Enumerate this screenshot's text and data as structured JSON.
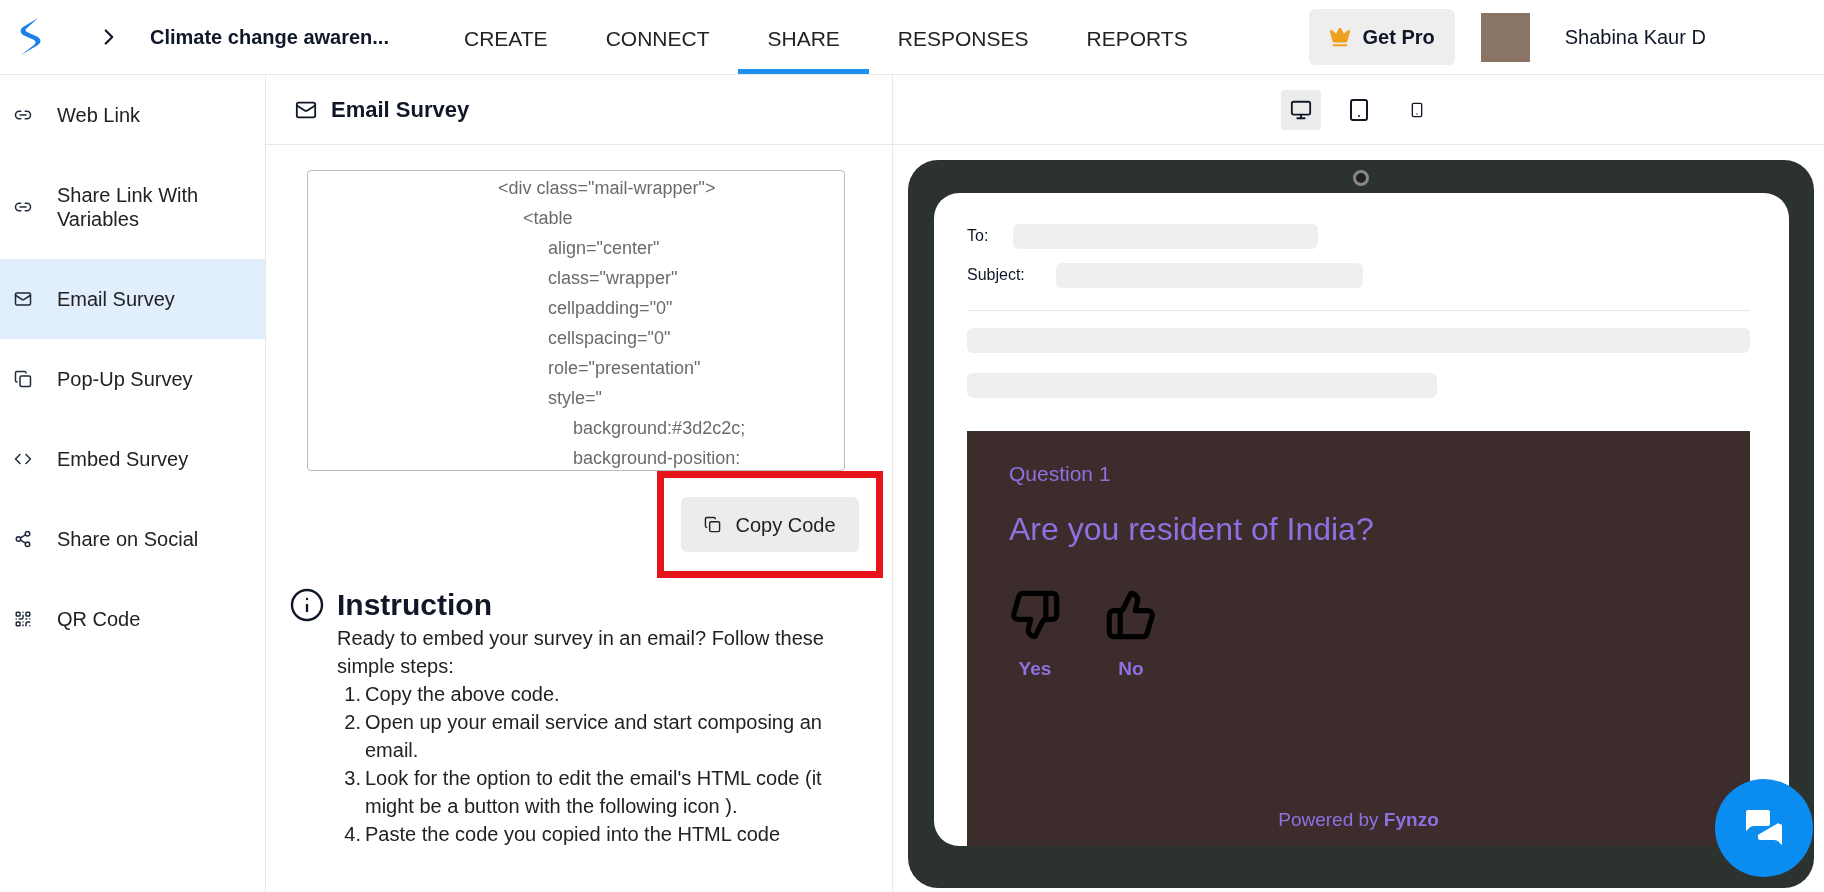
{
  "header": {
    "page_title": "Climate change awaren...",
    "tabs": [
      {
        "label": "CREATE",
        "selected": false
      },
      {
        "label": "CONNECT",
        "selected": false
      },
      {
        "label": "SHARE",
        "selected": true
      },
      {
        "label": "RESPONSES",
        "selected": false
      },
      {
        "label": "REPORTS",
        "selected": false
      }
    ],
    "get_pro": "Get Pro",
    "user_name": "Shabina Kaur D"
  },
  "sidebar": {
    "items": [
      {
        "label": "Web Link",
        "kind": "link",
        "selected": false
      },
      {
        "label": "Share Link With Variables",
        "kind": "link",
        "selected": false
      },
      {
        "label": "Email Survey",
        "kind": "mail",
        "selected": true
      },
      {
        "label": "Pop-Up Survey",
        "kind": "popup",
        "selected": false
      },
      {
        "label": "Embed Survey",
        "kind": "code",
        "selected": false
      },
      {
        "label": "Share on Social",
        "kind": "share",
        "selected": false
      },
      {
        "label": "QR Code",
        "kind": "qr",
        "selected": false
      }
    ]
  },
  "panel": {
    "title": "Email Survey",
    "code_lines": [
      "                                    <div class=\"mail-wrapper\">",
      "                                         <table",
      "                                              align=\"center\"",
      "                                              class=\"wrapper\"",
      "                                              cellpadding=\"0\"",
      "                                              cellspacing=\"0\"",
      "                                              role=\"presentation\"",
      "                                              style=\"",
      "                                                   background:#3d2c2c;",
      "                                                   background-position:"
    ],
    "copy_button": "Copy Code",
    "instruction": {
      "title": "Instruction",
      "intro": "Ready to embed your survey in an email? Follow these simple steps:",
      "steps": [
        {
          "number": "1.",
          "text": "Copy the above code."
        },
        {
          "number": "2.",
          "text": "Open up your email service and start composing an email."
        },
        {
          "number": "3.",
          "text": "Look for the option to edit the email's HTML code (it might be a button with the following icon )."
        },
        {
          "number": "4.",
          "text": "Paste the code you copied into the HTML code"
        }
      ]
    }
  },
  "preview": {
    "devices": [
      {
        "kind": "desktop",
        "selected": true
      },
      {
        "kind": "tablet",
        "selected": false
      },
      {
        "kind": "phone",
        "selected": false
      }
    ],
    "email": {
      "to_label": "To:",
      "subject_label": "Subject:"
    },
    "survey": {
      "question_number": "Question 1",
      "question": "Are you resident of India?",
      "options": [
        {
          "label": "Yes",
          "kind": "thumbs_down"
        },
        {
          "label": "No",
          "kind": "thumbs_up"
        }
      ],
      "powered_by": "Powered by **Fynzo**"
    }
  }
}
